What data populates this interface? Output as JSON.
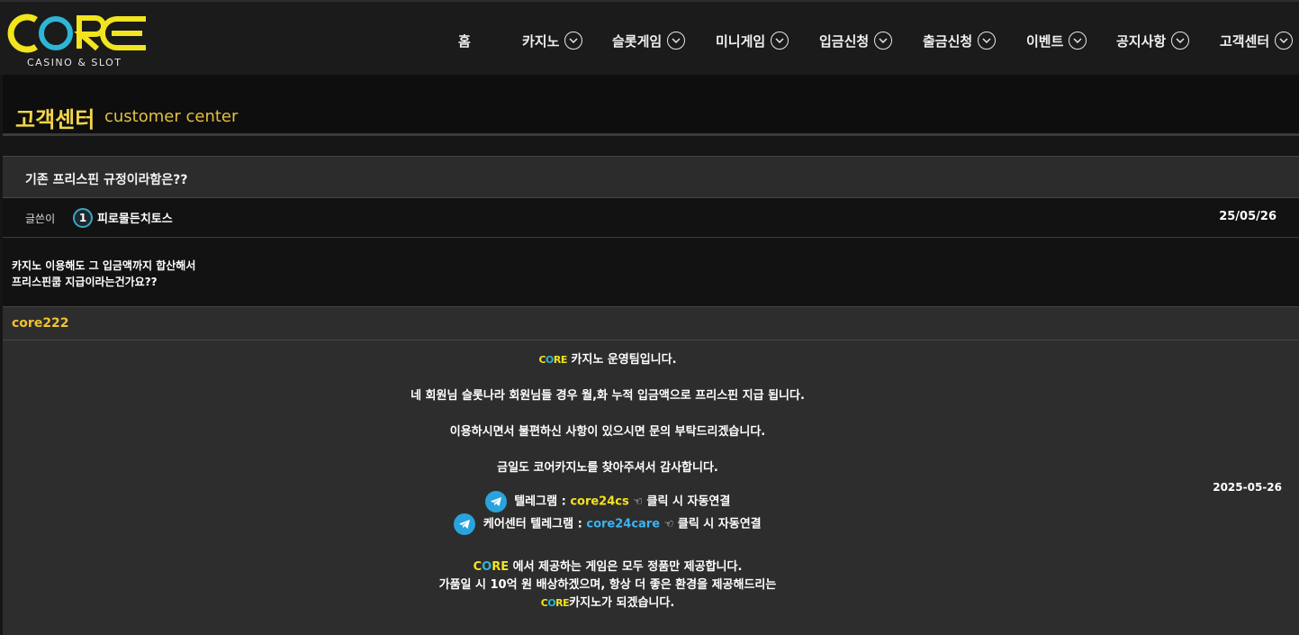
{
  "logo": {
    "text": "CORE",
    "subtitle": "CASINO & SLOT"
  },
  "nav": {
    "items": [
      {
        "label": "홈",
        "chevron": false
      },
      {
        "label": "카지노",
        "chevron": true
      },
      {
        "label": "슬롯게임",
        "chevron": true
      },
      {
        "label": "미니게임",
        "chevron": true
      },
      {
        "label": "입금신청",
        "chevron": true
      },
      {
        "label": "출금신청",
        "chevron": true
      },
      {
        "label": "이벤트",
        "chevron": true
      },
      {
        "label": "공지사항",
        "chevron": true
      },
      {
        "label": "고객센터",
        "chevron": true
      }
    ]
  },
  "page": {
    "title_ko": "고객센터",
    "title_en": "customer center"
  },
  "post": {
    "subject": "기존 프리스핀 규정이라함은??",
    "author_label": "글쓴이",
    "level": "1",
    "author": "피로물든치토스",
    "date": "25/05/26",
    "body": [
      "카지노 이용해도 그 입금액까지 합산해서",
      "프리스핀쿱 지급이라는건가요??"
    ]
  },
  "reply": {
    "author": "core222",
    "date": "2025-05-26",
    "line1": "카지노 운영팀입니다.",
    "line2": "네 회원님 슬롯나라 회원님들 경우 월,화 누적 입금액으로 프리스핀 지급 됩니다.",
    "line3": "이용하시면서 불편하신 사항이 있으시면 문의 부탁드리겠습니다.",
    "line4": "금일도 코어카지노를 찾아주셔서 감사합니다.",
    "telegram1_label": "텔레그램 :",
    "telegram1_id": "core24cs",
    "telegram1_suffix": "클릭 시 자동연결",
    "telegram2_label": "케어센터 텔레그램 :",
    "telegram2_id": "core24care",
    "telegram2_suffix": "클릭 시 자동연결",
    "core_word": "CORE",
    "line5": "에서 제공하는 게임은 모두 정품만 제공합니다.",
    "line6": "가품일 시 10억 원 배상하겠으며, 항상 더 좋은 환경을 제공해드리는",
    "line7": "카지노가 되겠습니다."
  },
  "colors": {
    "brand_yellow": "#f2e41d",
    "brand_blue": "#2db6d6",
    "title_gold": "#f2d54a",
    "telegram_blue": "#2aa3dc"
  }
}
